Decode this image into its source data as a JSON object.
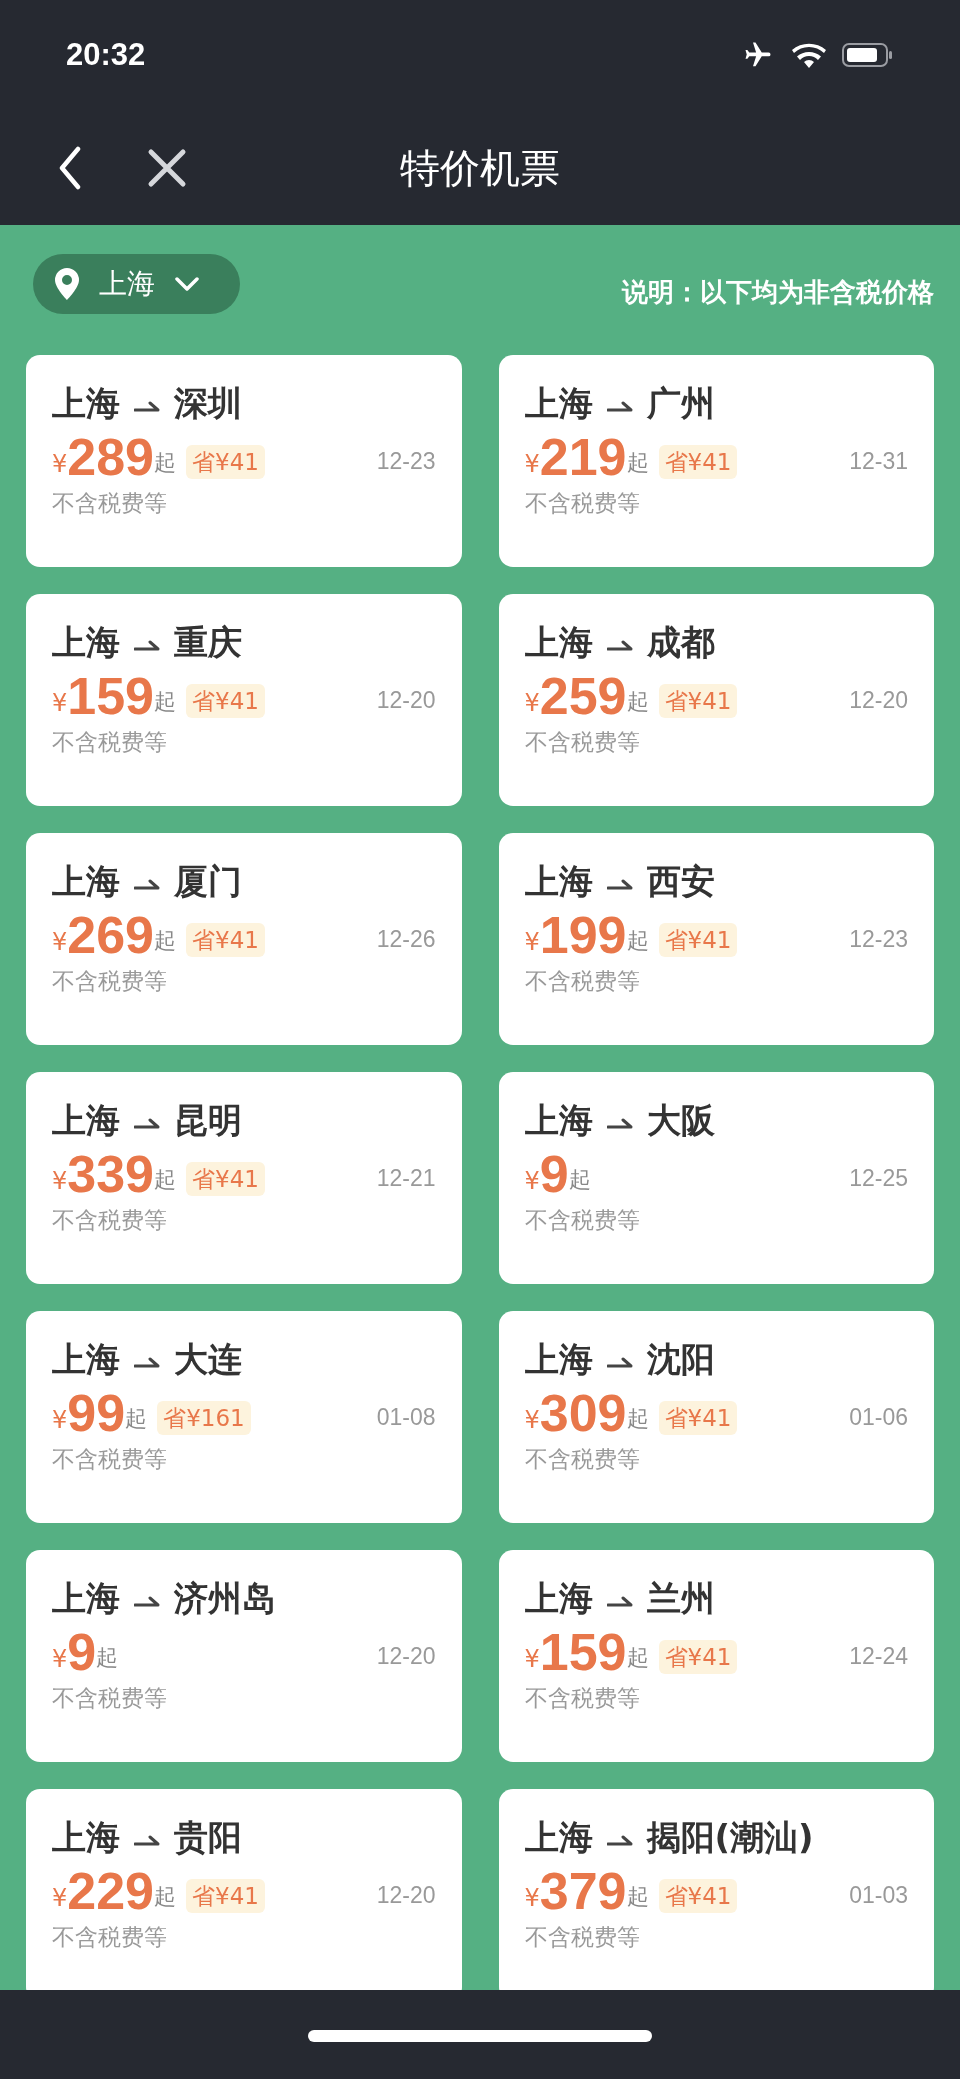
{
  "status_bar": {
    "time": "20:32"
  },
  "nav": {
    "title": "特价机票"
  },
  "city_selector": {
    "label": "上海"
  },
  "note": "说明：以下均为非含税价格",
  "deals": [
    {
      "from": "上海",
      "to": "深圳",
      "currency": "¥",
      "price": "289",
      "suffix": "起",
      "savings": "省¥41",
      "date": "12-23",
      "footnote": "不含税费等"
    },
    {
      "from": "上海",
      "to": "广州",
      "currency": "¥",
      "price": "219",
      "suffix": "起",
      "savings": "省¥41",
      "date": "12-31",
      "footnote": "不含税费等"
    },
    {
      "from": "上海",
      "to": "重庆",
      "currency": "¥",
      "price": "159",
      "suffix": "起",
      "savings": "省¥41",
      "date": "12-20",
      "footnote": "不含税费等"
    },
    {
      "from": "上海",
      "to": "成都",
      "currency": "¥",
      "price": "259",
      "suffix": "起",
      "savings": "省¥41",
      "date": "12-20",
      "footnote": "不含税费等"
    },
    {
      "from": "上海",
      "to": "厦门",
      "currency": "¥",
      "price": "269",
      "suffix": "起",
      "savings": "省¥41",
      "date": "12-26",
      "footnote": "不含税费等"
    },
    {
      "from": "上海",
      "to": "西安",
      "currency": "¥",
      "price": "199",
      "suffix": "起",
      "savings": "省¥41",
      "date": "12-23",
      "footnote": "不含税费等"
    },
    {
      "from": "上海",
      "to": "昆明",
      "currency": "¥",
      "price": "339",
      "suffix": "起",
      "savings": "省¥41",
      "date": "12-21",
      "footnote": "不含税费等"
    },
    {
      "from": "上海",
      "to": "大阪",
      "currency": "¥",
      "price": "9",
      "suffix": "起",
      "date": "12-25",
      "footnote": "不含税费等"
    },
    {
      "from": "上海",
      "to": "大连",
      "currency": "¥",
      "price": "99",
      "suffix": "起",
      "savings": "省¥161",
      "date": "01-08",
      "footnote": "不含税费等"
    },
    {
      "from": "上海",
      "to": "沈阳",
      "currency": "¥",
      "price": "309",
      "suffix": "起",
      "savings": "省¥41",
      "date": "01-06",
      "footnote": "不含税费等"
    },
    {
      "from": "上海",
      "to": "济州岛",
      "currency": "¥",
      "price": "9",
      "suffix": "起",
      "date": "12-20",
      "footnote": "不含税费等"
    },
    {
      "from": "上海",
      "to": "兰州",
      "currency": "¥",
      "price": "159",
      "suffix": "起",
      "savings": "省¥41",
      "date": "12-24",
      "footnote": "不含税费等"
    },
    {
      "from": "上海",
      "to": "贵阳",
      "currency": "¥",
      "price": "229",
      "suffix": "起",
      "savings": "省¥41",
      "date": "12-20",
      "footnote": "不含税费等"
    },
    {
      "from": "上海",
      "to": "揭阳(潮汕)",
      "currency": "¥",
      "price": "379",
      "suffix": "起",
      "savings": "省¥41",
      "date": "01-03",
      "footnote": "不含税费等"
    }
  ]
}
